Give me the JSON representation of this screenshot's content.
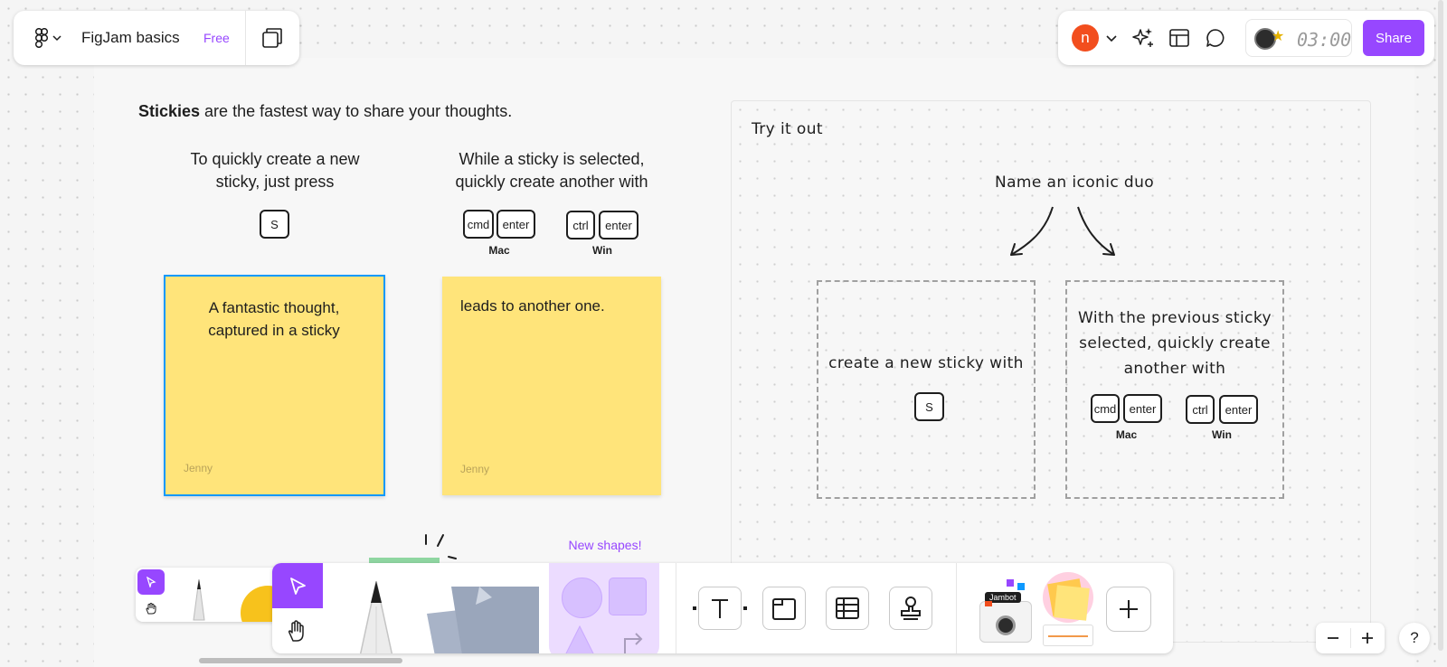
{
  "header": {
    "file_name": "FigJam basics",
    "plan_badge": "Free",
    "avatar_initial": "n",
    "timer": "03:00",
    "share_label": "Share"
  },
  "board": {
    "intro_bold": "Stickies",
    "intro_rest": " are the fastest way to share your thoughts.",
    "col1_text": "To quickly create a new sticky, just press",
    "col1_key": "S",
    "col2_text": "While a sticky is selected, quickly create another with",
    "mac_keys": [
      "cmd",
      "enter"
    ],
    "win_keys": [
      "ctrl",
      "enter"
    ],
    "mac_label": "Mac",
    "win_label": "Win",
    "sticky1_text": "A fantastic thought, captured in a sticky",
    "sticky1_author": "Jenny",
    "sticky2_text": "leads to another one.",
    "sticky2_author": "Jenny"
  },
  "try_section": {
    "title": "Try it out",
    "prompt": "Name an iconic duo",
    "box1_text": "create a new sticky with",
    "box1_key": "S",
    "box2_text": "With the previous sticky selected, quickly create another with"
  },
  "toolbar": {
    "new_shapes_label": "New shapes!",
    "jambot_label": "Jambot"
  },
  "colors": {
    "accent": "#9747ff",
    "sticky": "#ffe47a",
    "selection": "#0d99ff",
    "avatar": "#f24e1e"
  }
}
